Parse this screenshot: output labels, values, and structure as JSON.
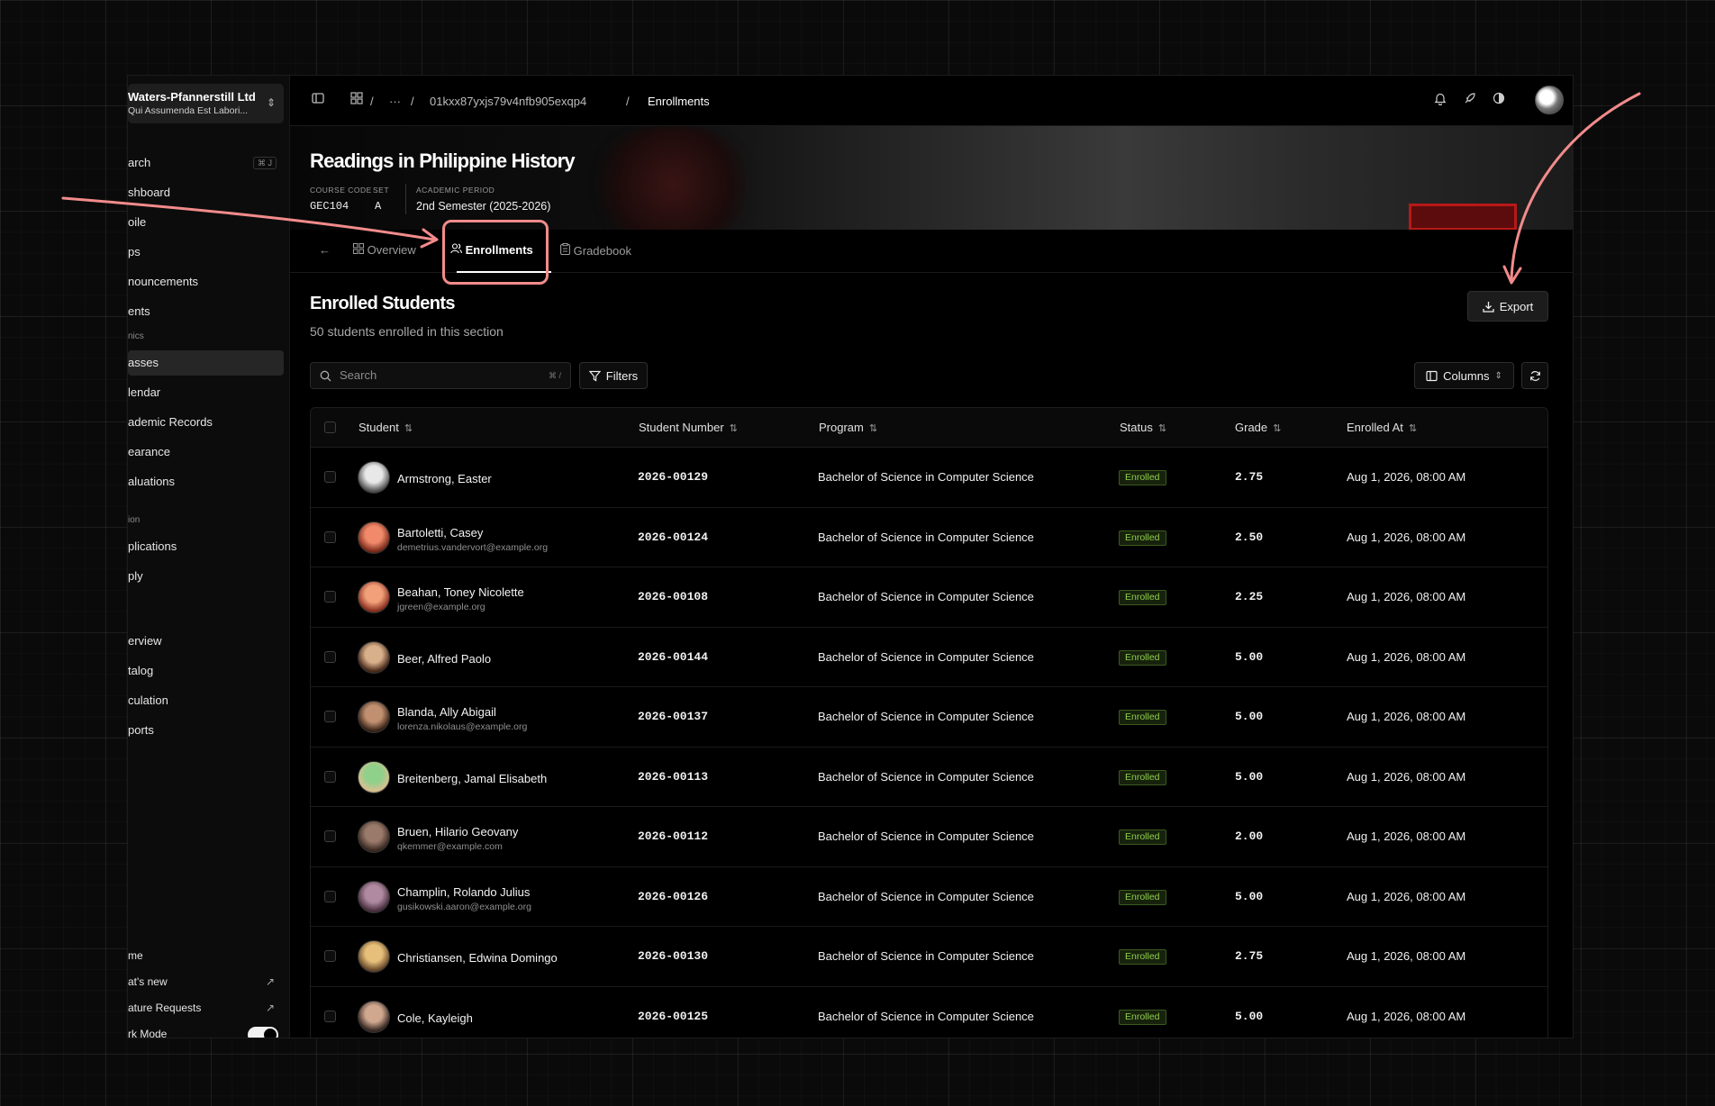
{
  "org": {
    "name": "Waters-Pfannerstill Ltd",
    "subtitle": "Qui Assumenda Est Labori..."
  },
  "sidebar": {
    "search_label": "arch",
    "search_shortcut": "⌘ J",
    "items": [
      {
        "label": "shboard"
      },
      {
        "label": "oile"
      },
      {
        "label": "ps"
      },
      {
        "label": "nouncements"
      },
      {
        "label": "ents"
      }
    ],
    "section_academics": "nics",
    "academics": [
      {
        "label": "asses",
        "active": true
      },
      {
        "label": "lendar"
      },
      {
        "label": "ademic Records"
      },
      {
        "label": "earance"
      },
      {
        "label": "aluations"
      }
    ],
    "section_admission": "ion",
    "admission": [
      {
        "label": "plications"
      },
      {
        "label": "ply"
      }
    ],
    "misc": [
      {
        "label": "erview"
      },
      {
        "label": "talog"
      },
      {
        "label": "culation"
      },
      {
        "label": "ports"
      }
    ],
    "footer": [
      {
        "label": "me"
      },
      {
        "label": "at's new"
      },
      {
        "label": "ature Requests"
      },
      {
        "label": "rk Mode"
      }
    ]
  },
  "breadcrumb": {
    "id": "01kxx87yxjs79v4nfb905exqp4",
    "current": "Enrollments",
    "ellipsis": "···"
  },
  "course": {
    "title": "Readings in Philippine History",
    "code_label": "COURSE CODE",
    "code": "GEC104",
    "set_label": "SET",
    "set": "A",
    "period_label": "ACADEMIC PERIOD",
    "period": "2nd Semester (2025-2026)"
  },
  "tabs": [
    {
      "label": "Overview"
    },
    {
      "label": "Enrollments",
      "active": true
    },
    {
      "label": "Gradebook"
    }
  ],
  "section": {
    "title": "Enrolled Students",
    "subtitle": "50 students enrolled in this section"
  },
  "toolbar": {
    "export": "Export",
    "search_placeholder": "Search",
    "search_shortcut": "⌘ /",
    "filters": "Filters",
    "columns": "Columns"
  },
  "table": {
    "headers": {
      "student": "Student",
      "number": "Student Number",
      "program": "Program",
      "status": "Status",
      "grade": "Grade",
      "enrolled_at": "Enrolled At"
    },
    "rows": [
      {
        "name": "Armstrong, Easter",
        "email": "",
        "number": "2026-00129",
        "program": "Bachelor of Science in Computer Science",
        "status": "Enrolled",
        "grade": "2.75",
        "enrolled_at": "Aug 1, 2026, 08:00 AM"
      },
      {
        "name": "Bartoletti, Casey",
        "email": "demetrius.vandervort@example.org",
        "number": "2026-00124",
        "program": "Bachelor of Science in Computer Science",
        "status": "Enrolled",
        "grade": "2.50",
        "enrolled_at": "Aug 1, 2026, 08:00 AM"
      },
      {
        "name": "Beahan, Toney Nicolette",
        "email": "jgreen@example.org",
        "number": "2026-00108",
        "program": "Bachelor of Science in Computer Science",
        "status": "Enrolled",
        "grade": "2.25",
        "enrolled_at": "Aug 1, 2026, 08:00 AM"
      },
      {
        "name": "Beer, Alfred Paolo",
        "email": "",
        "number": "2026-00144",
        "program": "Bachelor of Science in Computer Science",
        "status": "Enrolled",
        "grade": "5.00",
        "enrolled_at": "Aug 1, 2026, 08:00 AM"
      },
      {
        "name": "Blanda, Ally Abigail",
        "email": "lorenza.nikolaus@example.org",
        "number": "2026-00137",
        "program": "Bachelor of Science in Computer Science",
        "status": "Enrolled",
        "grade": "5.00",
        "enrolled_at": "Aug 1, 2026, 08:00 AM"
      },
      {
        "name": "Breitenberg, Jamal Elisabeth",
        "email": "",
        "number": "2026-00113",
        "program": "Bachelor of Science in Computer Science",
        "status": "Enrolled",
        "grade": "5.00",
        "enrolled_at": "Aug 1, 2026, 08:00 AM"
      },
      {
        "name": "Bruen, Hilario Geovany",
        "email": "qkemmer@example.com",
        "number": "2026-00112",
        "program": "Bachelor of Science in Computer Science",
        "status": "Enrolled",
        "grade": "2.00",
        "enrolled_at": "Aug 1, 2026, 08:00 AM"
      },
      {
        "name": "Champlin, Rolando Julius",
        "email": "gusikowski.aaron@example.org",
        "number": "2026-00126",
        "program": "Bachelor of Science in Computer Science",
        "status": "Enrolled",
        "grade": "5.00",
        "enrolled_at": "Aug 1, 2026, 08:00 AM"
      },
      {
        "name": "Christiansen, Edwina Domingo",
        "email": "",
        "number": "2026-00130",
        "program": "Bachelor of Science in Computer Science",
        "status": "Enrolled",
        "grade": "2.75",
        "enrolled_at": "Aug 1, 2026, 08:00 AM"
      },
      {
        "name": "Cole, Kayleigh",
        "email": "",
        "number": "2026-00125",
        "program": "Bachelor of Science in Computer Science",
        "status": "Enrolled",
        "grade": "5.00",
        "enrolled_at": "Aug 1, 2026, 08:00 AM"
      }
    ]
  },
  "colors": {
    "accent_annotation": "#f28b8b",
    "badge_text": "#8fd04a",
    "badge_border": "#3b5a1f"
  },
  "icons": [
    "sidebar-toggle-icon",
    "grid-icon",
    "bell-icon",
    "rocket-icon",
    "contrast-icon",
    "download-icon",
    "filter-icon",
    "columns-icon",
    "refresh-icon",
    "search-icon",
    "users-icon",
    "clipboard-icon",
    "back-arrow-icon"
  ]
}
